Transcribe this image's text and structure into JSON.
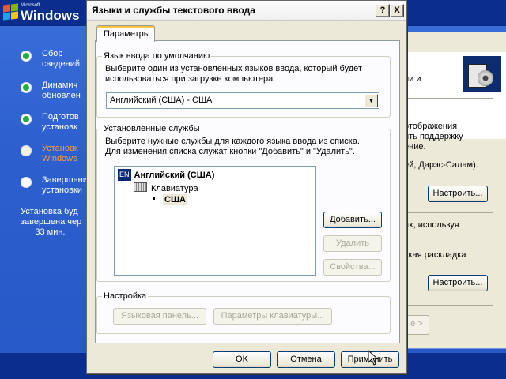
{
  "setup": {
    "logo": {
      "small": "Microsoft",
      "name": "Windows"
    },
    "steps": [
      {
        "label": "Сбор\nсведений",
        "state": "done"
      },
      {
        "label": "Динамич\nобновлен",
        "state": "done"
      },
      {
        "label": "Подготов\nустановк",
        "state": "done"
      },
      {
        "label": "Установк\nWindows",
        "state": "current"
      },
      {
        "label": "Завершение\nустановки",
        "state": "pending"
      }
    ],
    "eta": "Установка буд\nзавершена чер\n      33 мин."
  },
  "back_window": {
    "text_1": "ии и",
    "text_2": "отображения\nить поддержку\nение.",
    "text_3": "ей, Дарэс-Салам).",
    "text_4": "ах, используя",
    "text_5": "ская раскладка",
    "settings_button_1": "Настроить...",
    "settings_button_2": "Настроить...",
    "next_fragment": "e >"
  },
  "dialog": {
    "title": "Языки и службы текстового ввода",
    "help_glyph": "?",
    "close_glyph": "X",
    "tab_label": "Параметры",
    "default_group": {
      "legend": "Язык ввода по умолчанию",
      "description": "Выберите один из установленных языков ввода, который будет\nиспользоваться при загрузке компьютера.",
      "selected": "Английский (США) - США"
    },
    "installed_group": {
      "legend": "Установленные службы",
      "description": "Выберите нужные службы для каждого языка ввода из списка.\nДля изменения списка служат кнопки \"Добавить\" и \"Удалить\".",
      "tree": {
        "badge": "EN",
        "language": "Английский (США)",
        "category": "Клавиатура",
        "layout": "США"
      },
      "add_label": "Добавить...",
      "remove_label": "Удалить",
      "props_label": "Свойства..."
    },
    "settings_group": {
      "legend": "Настройка",
      "lang_bar_label": "Языковая панель...",
      "kbd_settings_label": "Параметры клавиатуры..."
    },
    "ok_label": "OK",
    "cancel_label": "Отмена",
    "apply_label": "Применить"
  }
}
